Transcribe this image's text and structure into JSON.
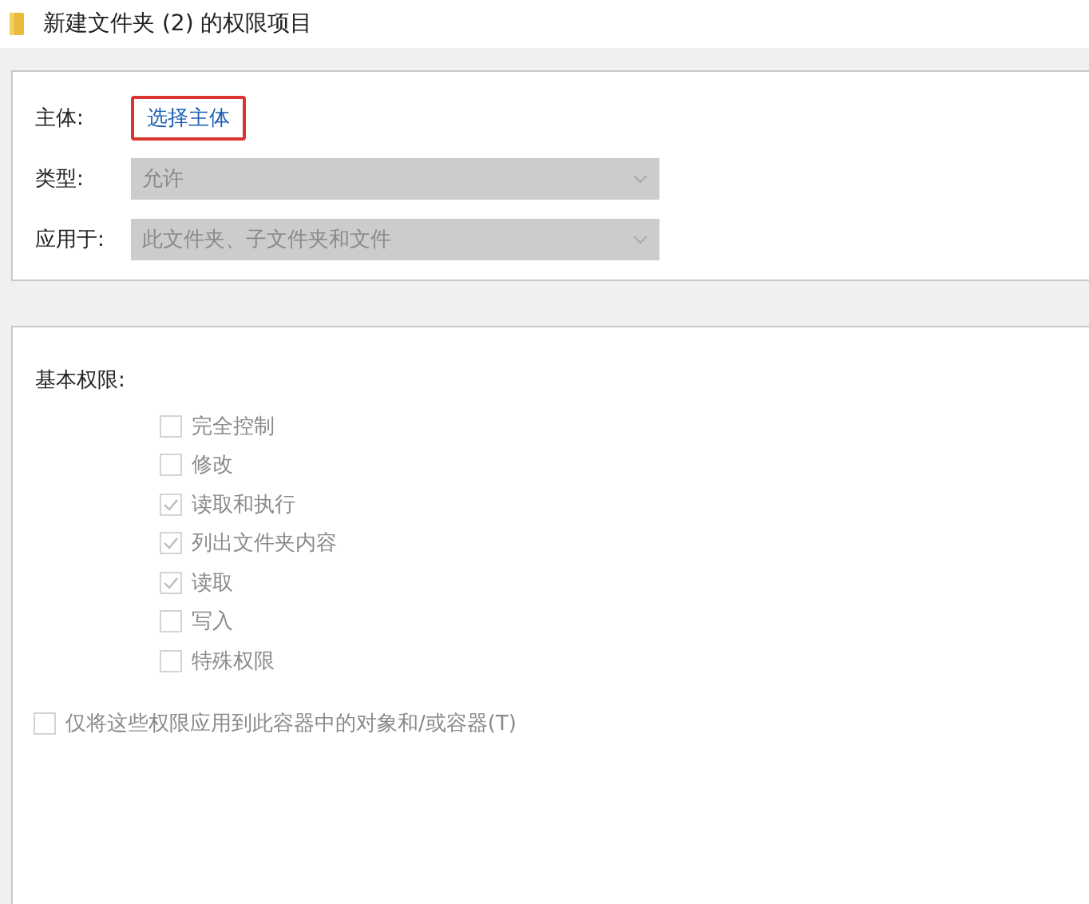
{
  "window": {
    "title": "新建文件夹 (2) 的权限项目"
  },
  "principal": {
    "label": "主体:",
    "link": "选择主体",
    "highlighted": true
  },
  "fields": [
    {
      "label": "类型:",
      "value": "允许",
      "disabled": true
    },
    {
      "label": "应用于:",
      "value": "此文件夹、子文件夹和文件",
      "disabled": true
    }
  ],
  "permissions": {
    "heading": "基本权限:",
    "items": [
      {
        "label": "完全控制",
        "checked": false,
        "disabled": true
      },
      {
        "label": "修改",
        "checked": false,
        "disabled": true
      },
      {
        "label": "读取和执行",
        "checked": true,
        "disabled": true
      },
      {
        "label": "列出文件夹内容",
        "checked": true,
        "disabled": true
      },
      {
        "label": "读取",
        "checked": true,
        "disabled": true
      },
      {
        "label": "写入",
        "checked": false,
        "disabled": true
      },
      {
        "label": "特殊权限",
        "checked": false,
        "disabled": true
      }
    ]
  },
  "apply_only": {
    "label": "仅将这些权限应用到此容器中的对象和/或容器(T)",
    "checked": false,
    "disabled": true
  }
}
